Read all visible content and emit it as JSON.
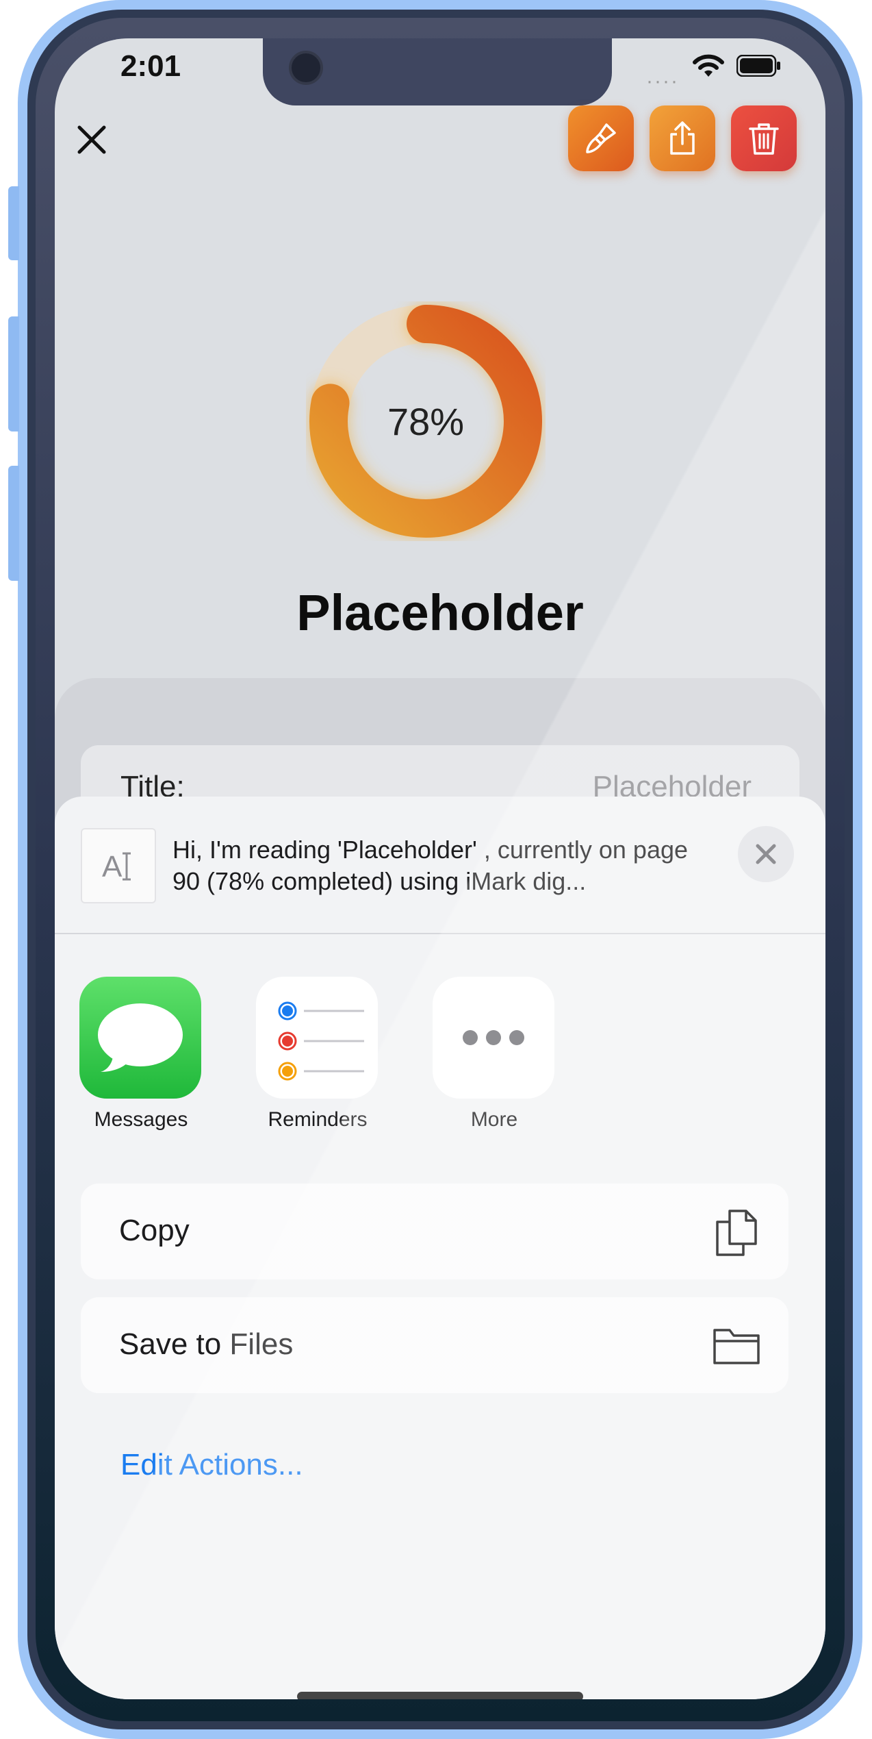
{
  "status_bar": {
    "time": "2:01",
    "signal": "····",
    "icons": [
      "wifi-icon",
      "battery-icon"
    ]
  },
  "header": {
    "close_icon": "close-icon",
    "buttons": [
      {
        "name": "paintbrush",
        "icon": "paintbrush-icon"
      },
      {
        "name": "share",
        "icon": "share-icon"
      },
      {
        "name": "trash",
        "icon": "trash-icon"
      }
    ]
  },
  "progress": {
    "percent_label": "78%",
    "fraction": 0.78
  },
  "book": {
    "title": "Placeholder"
  },
  "detail": {
    "label": "Title:",
    "value": "Placeholder"
  },
  "share_sheet": {
    "preview_icon": "text-format-icon",
    "preview_icon_glyph": "A",
    "preview_text": "Hi, I'm reading 'Placeholder' , currently on page 90 (78% completed) using iMark dig...",
    "close_icon": "close-icon",
    "apps": [
      {
        "label": "Messages",
        "icon": "messages-icon"
      },
      {
        "label": "Reminders",
        "icon": "reminders-icon"
      },
      {
        "label": "More",
        "icon": "more-icon"
      }
    ],
    "actions": [
      {
        "label": "Copy",
        "icon": "copy-icon"
      },
      {
        "label": "Save to Files",
        "icon": "folder-icon"
      }
    ],
    "edit_actions": "Edit Actions..."
  },
  "colors": {
    "accent_orange": "#e06a22",
    "ring_start": "#e8a431",
    "ring_end": "#d9541e",
    "link_blue": "#1a7cf0",
    "messages_green": "#34c84a",
    "trash_red": "#d94040"
  }
}
